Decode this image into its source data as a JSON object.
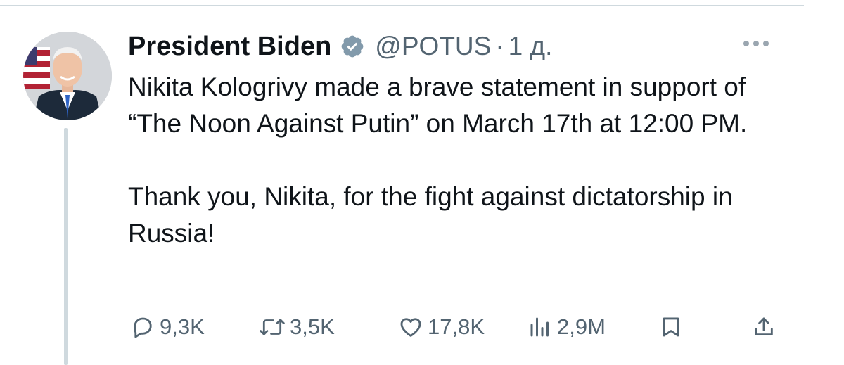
{
  "tweet": {
    "author": {
      "name": "President Biden",
      "handle": "@POTUS",
      "separator": "·",
      "time": "1 д.",
      "verified": true
    },
    "text": {
      "paragraph_1": "Nikita Kologrivy made a brave statement in support of “The Noon Against Putin” on March 17th at 12:00 PM.",
      "paragraph_2": "Thank you, Nikita, for the fight against dictatorship in Russia!"
    },
    "stats": {
      "replies": "9,3K",
      "reposts": "3,5K",
      "likes": "17,8K",
      "views": "2,9M"
    }
  },
  "icons": {
    "reply": "reply-icon",
    "repost": "repost-icon",
    "like": "heart-icon",
    "views": "views-chart-icon",
    "bookmark": "bookmark-icon",
    "share": "share-icon",
    "more": "more-dots-icon",
    "verified": "verified-badge-icon"
  },
  "colors": {
    "text_primary": "#0f1419",
    "text_secondary": "#536471",
    "divider": "#cfd9de",
    "verified_badge": "#829aab"
  }
}
